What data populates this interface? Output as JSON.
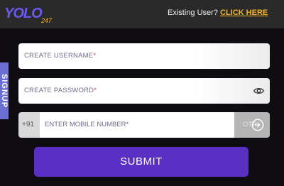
{
  "header": {
    "logo_text": "YOLO",
    "logo_suffix": "247",
    "existing_user_text": "Existing User?",
    "click_here_label": "CLICK HERE"
  },
  "side_tab": {
    "label": "SIGNUP"
  },
  "form": {
    "username_placeholder": "CREATE USERNAME",
    "password_placeholder": "CREATE PASSWORD",
    "country_code": "+91",
    "mobile_placeholder": "ENTER MOBILE NUMBER",
    "required_mark": "*",
    "otp_label": "OTP",
    "submit_label": "SUBMIT"
  },
  "colors": {
    "accent_link": "#f0b323",
    "submit_bg": "#5a2fc4",
    "side_tab_bg": "#6a6fd4",
    "logo_color": "#6a5af2"
  },
  "icons": [
    "eye-icon",
    "arrow-right-circle-icon"
  ]
}
